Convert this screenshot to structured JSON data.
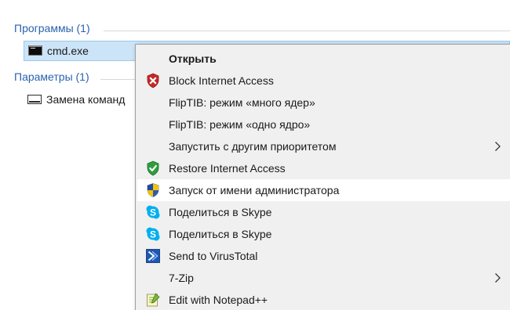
{
  "results": {
    "groups": [
      {
        "header": "Программы (1)",
        "items": [
          {
            "label": "cmd.exe",
            "icon": "cmd-icon",
            "selected": true
          }
        ]
      },
      {
        "header": "Параметры (1)",
        "items": [
          {
            "label": "Замена команд",
            "icon": "console-icon",
            "selected": false
          }
        ]
      }
    ]
  },
  "context_menu": {
    "items": [
      {
        "label": "Открыть",
        "icon": "",
        "bold": true
      },
      {
        "label": "Block Internet Access",
        "icon": "shield-red-x-icon"
      },
      {
        "label": "FlipTIB: режим «много ядер»",
        "icon": ""
      },
      {
        "label": "FlipTIB: режим «одно ядро»",
        "icon": ""
      },
      {
        "label": "Запустить с другим приоритетом",
        "icon": "",
        "submenu": true
      },
      {
        "label": "Restore Internet Access",
        "icon": "shield-green-check-icon"
      },
      {
        "label": "Запуск от имени администратора",
        "icon": "uac-shield-icon",
        "hovered": true
      },
      {
        "label": "Поделиться в Skype",
        "icon": "skype-icon"
      },
      {
        "label": "Поделиться в Skype",
        "icon": "skype-icon"
      },
      {
        "label": "Send to VirusTotal",
        "icon": "virustotal-icon"
      },
      {
        "label": "7-Zip",
        "icon": "",
        "submenu": true
      },
      {
        "label": "Edit with Notepad++",
        "icon": "notepad-plus-plus-icon"
      }
    ]
  },
  "colors": {
    "group_header": "#2a63ad",
    "selection_bg": "#cce4f7",
    "selection_border": "#99c9ef",
    "menu_bg": "#f0f0f0",
    "menu_hover_bg": "#ffffff"
  }
}
